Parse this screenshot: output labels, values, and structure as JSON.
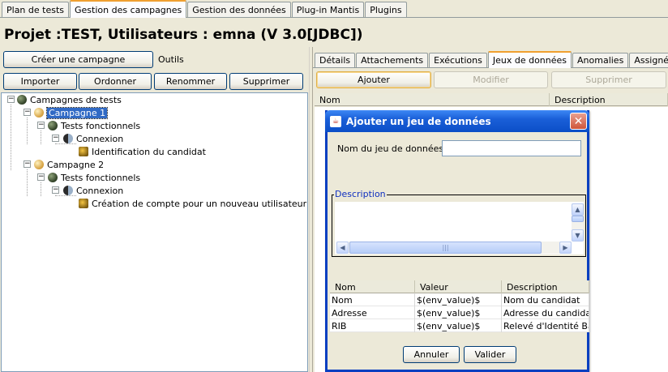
{
  "top_tabs": [
    {
      "label": "Plan de tests",
      "active": false
    },
    {
      "label": "Gestion des campagnes",
      "active": true
    },
    {
      "label": "Gestion des données",
      "active": false
    },
    {
      "label": "Plug-in Mantis",
      "active": false
    },
    {
      "label": "Plugins",
      "active": false
    }
  ],
  "project_title": "Projet :TEST, Utilisateurs : emna (V 3.0[JDBC])",
  "left_panel": {
    "create_campaign_label": "Créer une campagne",
    "tools_label": "Outils",
    "buttons": {
      "import": "Importer",
      "order": "Ordonner",
      "rename": "Renommer",
      "delete": "Supprimer"
    },
    "tree": {
      "root": "Campagnes de tests",
      "campaign1": "Campagne 1",
      "c1_family": "Tests fonctionnels",
      "c1_suite": "Connexion",
      "c1_test": "Identification du candidat",
      "campaign2": "Campagne 2",
      "c2_family": "Tests fonctionnels",
      "c2_suite": "Connexion",
      "c2_test": "Création de compte pour un nouveau utilisateur"
    }
  },
  "right_panel": {
    "tabs": [
      {
        "label": "Détails",
        "active": false
      },
      {
        "label": "Attachements",
        "active": false
      },
      {
        "label": "Exécutions",
        "active": false
      },
      {
        "label": "Jeux de données",
        "active": true
      },
      {
        "label": "Anomalies",
        "active": false
      },
      {
        "label": "Assigné à",
        "active": false
      }
    ],
    "buttons": {
      "add": "Ajouter",
      "modify": "Modifier",
      "delete": "Supprimer"
    },
    "columns": {
      "name": "Nom",
      "description": "Description"
    }
  },
  "dialog": {
    "title": "Ajouter un jeu de données",
    "name_label": "Nom du jeu de données :",
    "name_value": "",
    "description_legend": "Description",
    "table": {
      "headers": {
        "name": "Nom",
        "value": "Valeur",
        "description": "Description"
      },
      "rows": [
        {
          "name": "Nom",
          "value": "$(env_value)$",
          "description": "Nom du candidat"
        },
        {
          "name": "Adresse",
          "value": "$(env_value)$",
          "description": "Adresse du candidat"
        },
        {
          "name": "RIB",
          "value": "$(env_value)$",
          "description": "Relevé d'Identité Ba..."
        }
      ]
    },
    "cancel_label": "Annuler",
    "ok_label": "Valider"
  }
}
